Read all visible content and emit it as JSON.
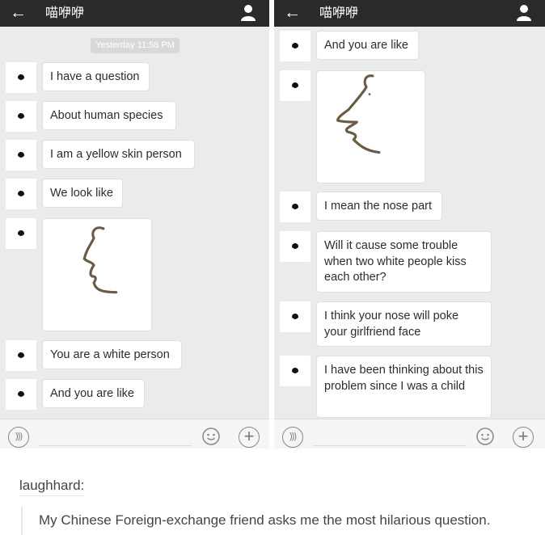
{
  "left_panel": {
    "header": {
      "back_icon": "back-arrow-icon",
      "title": "喵咿咿",
      "profile_icon": "person-icon"
    },
    "timestamp": "Yesterday 11:58 PM",
    "messages": [
      {
        "type": "text",
        "text": "I have a question"
      },
      {
        "type": "text",
        "text": "About human species"
      },
      {
        "type": "text",
        "text": "I am a yellow skin person"
      },
      {
        "type": "text",
        "text": "We look like"
      },
      {
        "type": "image",
        "description": "face-profile-drawing"
      },
      {
        "type": "text",
        "text": "You are a white person"
      },
      {
        "type": "text",
        "text": "And you are like"
      }
    ]
  },
  "right_panel": {
    "header": {
      "back_icon": "back-arrow-icon",
      "title": "喵咿咿",
      "profile_icon": "person-icon"
    },
    "messages": [
      {
        "type": "text",
        "text": "And you are like"
      },
      {
        "type": "image",
        "description": "face-profile-drawing-big-nose"
      },
      {
        "type": "text",
        "text": "I mean the nose part"
      },
      {
        "type": "text",
        "text": "Will it cause some trouble when two white people kiss each other?"
      },
      {
        "type": "text",
        "text": "I think your nose will poke your girlfriend face"
      },
      {
        "type": "text",
        "text": "I have been thinking about this problem since I was a child"
      }
    ]
  },
  "input_bar": {
    "voice_icon": "voice-icon",
    "emoji_icon": "emoji-icon",
    "plus_icon": "plus-icon"
  },
  "caption": {
    "username": "laughhard:",
    "quote": "My Chinese Foreign-exchange friend asks me the most hilarious question."
  },
  "colors": {
    "header_bg": "#2b2b2b",
    "chat_bg": "#ebebeb",
    "bubble_bg": "#ffffff",
    "drawing_stroke": "#6b5a44"
  }
}
